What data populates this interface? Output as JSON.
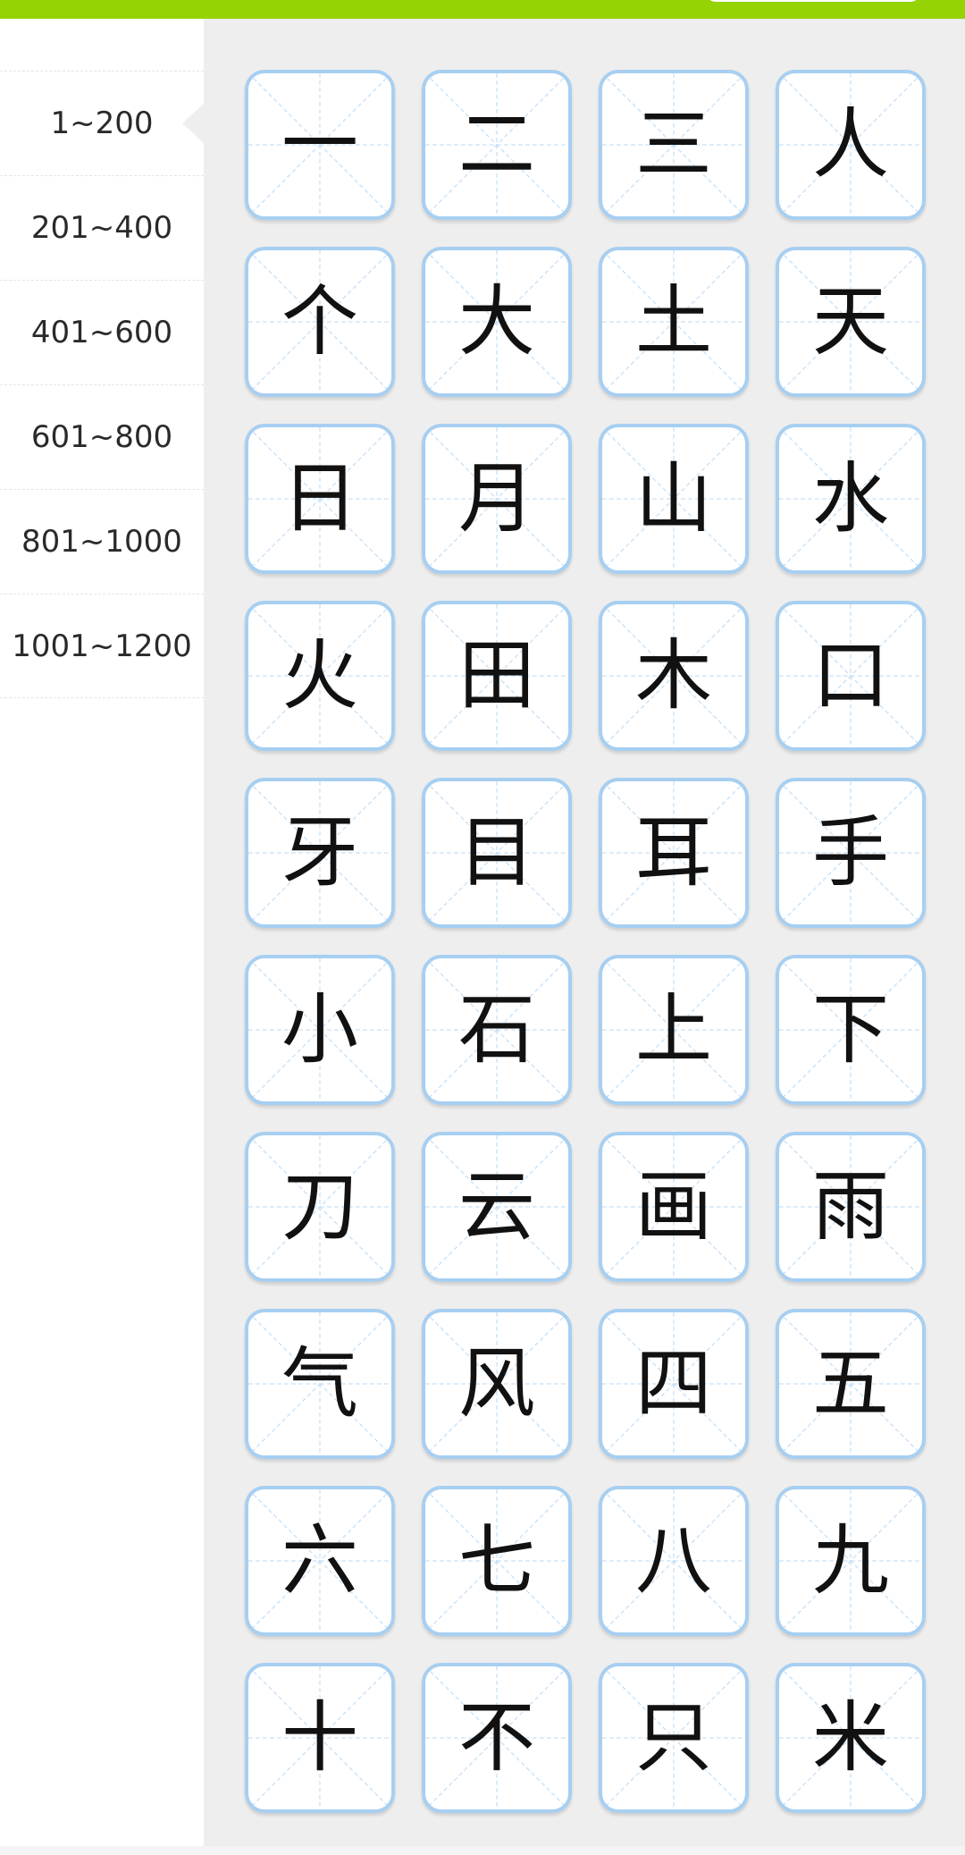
{
  "ranges": [
    {
      "label": "1~200",
      "active": true
    },
    {
      "label": "201~400",
      "active": false
    },
    {
      "label": "401~600",
      "active": false
    },
    {
      "label": "601~800",
      "active": false
    },
    {
      "label": "801~1000",
      "active": false
    },
    {
      "label": "1001~1200",
      "active": false
    }
  ],
  "characters": [
    "一",
    "二",
    "三",
    "人",
    "个",
    "大",
    "土",
    "天",
    "日",
    "月",
    "山",
    "水",
    "火",
    "田",
    "木",
    "口",
    "牙",
    "目",
    "耳",
    "手",
    "小",
    "石",
    "上",
    "下",
    "刀",
    "云",
    "画",
    "雨",
    "气",
    "风",
    "四",
    "五",
    "六",
    "七",
    "八",
    "九",
    "十",
    "不",
    "只",
    "米"
  ],
  "colors": {
    "header_bar": "#96d305",
    "card_border": "#a7cff1",
    "grid_guides": "#c6e0f6",
    "content_bg": "#eeeeee"
  }
}
